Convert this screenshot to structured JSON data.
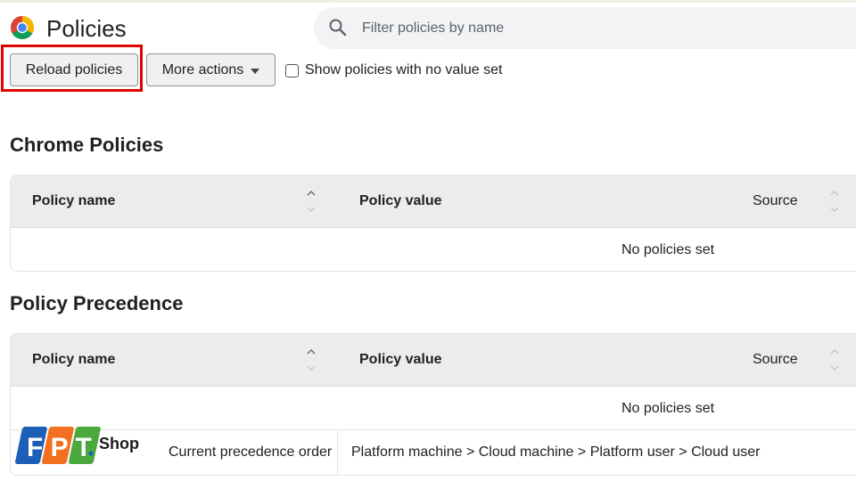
{
  "header": {
    "title": "Policies",
    "search_placeholder": "Filter policies by name"
  },
  "toolbar": {
    "reload_label": "Reload policies",
    "more_actions_label": "More actions",
    "show_unset_label": "Show policies with no value set",
    "show_unset_checked": false
  },
  "chrome_policies": {
    "title": "Chrome Policies",
    "columns": {
      "name": "Policy name",
      "value": "Policy value",
      "source": "Source"
    },
    "empty_text": "No policies set"
  },
  "policy_precedence": {
    "title": "Policy Precedence",
    "columns": {
      "name": "Policy name",
      "value": "Policy value",
      "source": "Source"
    },
    "empty_text": "No policies set",
    "row": {
      "label": "Current precedence order",
      "value": "Platform machine > Cloud machine > Platform user > Cloud user"
    }
  },
  "watermark": {
    "logo_text": "FPT",
    "label": "Shop"
  },
  "colors": {
    "highlight": "#e00000",
    "header_bg": "#ececec",
    "search_bg": "#f1f3f4",
    "fpt_blue": "#1c5fb7",
    "fpt_orange": "#f37021",
    "fpt_green": "#4aa83c"
  }
}
